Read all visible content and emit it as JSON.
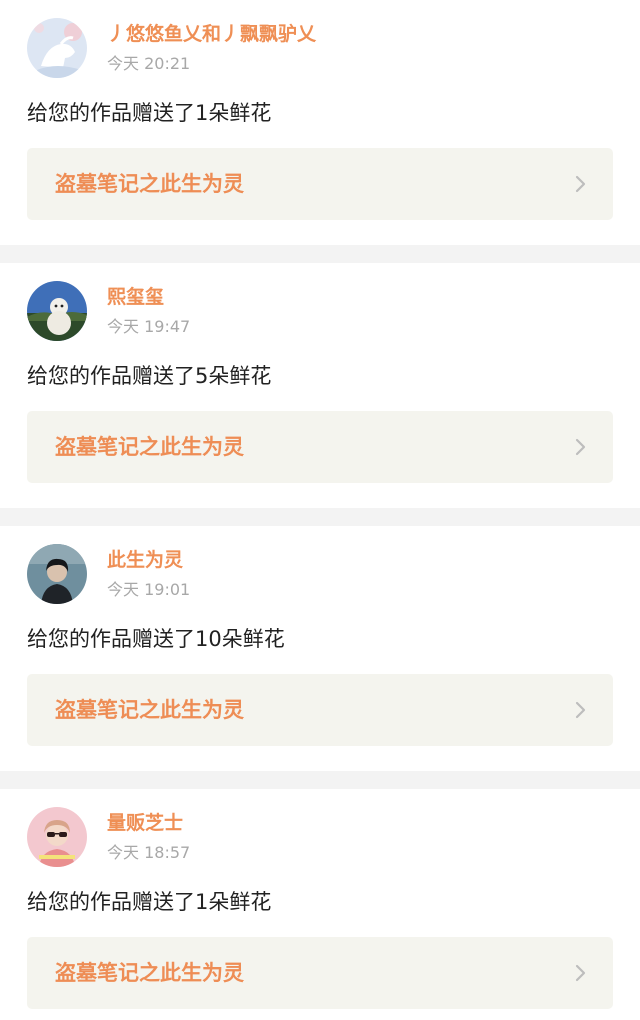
{
  "feed": [
    {
      "username": "丿悠悠鱼乂和丿飘飘驴乂",
      "time": "今天 20:21",
      "message": "给您的作品赠送了1朵鲜花",
      "work_title": "盗墓笔记之此生为灵",
      "avatar": "white-horse-illustration"
    },
    {
      "username": "熙玺玺",
      "time": "今天 19:47",
      "message": "给您的作品赠送了5朵鲜花",
      "work_title": "盗墓笔记之此生为灵",
      "avatar": "white-dog-photo"
    },
    {
      "username": "此生为灵",
      "time": "今天 19:01",
      "message": "给您的作品赠送了10朵鲜花",
      "work_title": "盗墓笔记之此生为灵",
      "avatar": "dark-haired-person-photo"
    },
    {
      "username": "量贩芝士",
      "time": "今天 18:57",
      "message": "给您的作品赠送了1朵鲜花",
      "work_title": "盗墓笔记之此生为灵",
      "avatar": "girl-with-sunglasses-photo"
    }
  ],
  "colors": {
    "username": "#ef8f55",
    "work_title": "#ee8d55",
    "timestamp": "#a8a8a8",
    "message": "#222222",
    "work_bg": "#f4f4ee",
    "divider": "#f3f3f3"
  },
  "icons": {
    "chevron": "chevron-right-icon"
  }
}
